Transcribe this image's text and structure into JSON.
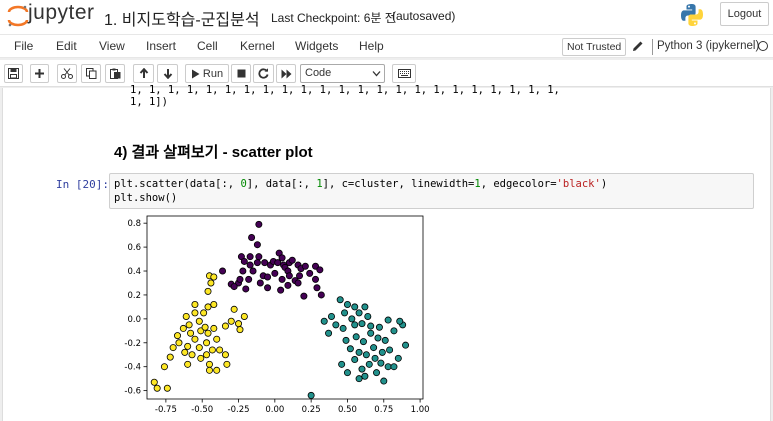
{
  "header": {
    "logo_text": "jupyter",
    "notebook_title": "1. 비지도학습-군집분석",
    "checkpoint": "Last Checkpoint: 6분 전",
    "autosaved": "(autosaved)",
    "logout_label": "Logout"
  },
  "menubar": {
    "items": [
      "File",
      "Edit",
      "View",
      "Insert",
      "Cell",
      "Kernel",
      "Widgets",
      "Help"
    ],
    "trust_label": "Not Trusted",
    "kernel_name": "Python 3 (ipykernel)"
  },
  "toolbar": {
    "run_label": "Run",
    "cell_type": "Code"
  },
  "notebook": {
    "output_tail_line1": "1, 1, 1, 1, 1, 1, 1, 1, 1, 1, 1, 1, 1, 1, 1, 1, 1, 1, 1, 1, 1, 1, 1,",
    "output_tail_line2": "1, 1])",
    "heading": "4) 결과 살펴보기 - scatter plot",
    "prompt": "In [20]:",
    "code_line1": "plt.scatter(data[:, 0], data[:, 1], c=cluster, linewidth=1, edgecolor='black')",
    "code_line2": "plt.show()"
  },
  "chart_data": {
    "type": "scatter",
    "title": "",
    "xlabel": "",
    "ylabel": "",
    "xlim": [
      -0.88,
      1.02
    ],
    "ylim": [
      -0.67,
      0.86
    ],
    "x_ticks": [
      "-0.75",
      "-0.50",
      "-0.25",
      "0.00",
      "0.25",
      "0.50",
      "0.75",
      "1.00"
    ],
    "x_tick_values": [
      -0.75,
      -0.5,
      -0.25,
      0.0,
      0.25,
      0.5,
      0.75,
      1.0
    ],
    "y_ticks": [
      "0.8",
      "0.6",
      "0.4",
      "0.2",
      "0.0",
      "-0.2",
      "-0.4",
      "-0.6"
    ],
    "y_tick_values": [
      0.8,
      0.6,
      0.4,
      0.2,
      0.0,
      -0.2,
      -0.4,
      -0.6
    ],
    "grid": false,
    "colors": {
      "cluster_0": "#440154",
      "cluster_1": "#21918c",
      "cluster_2": "#fde725"
    },
    "series": [
      {
        "cluster": 0,
        "points": [
          [
            -0.11,
            0.79
          ],
          [
            -0.16,
            0.68
          ],
          [
            -0.12,
            0.62
          ],
          [
            -0.23,
            0.52
          ],
          [
            -0.17,
            0.52
          ],
          [
            -0.11,
            0.52
          ],
          [
            -0.21,
            0.48
          ],
          [
            -0.12,
            0.47
          ],
          [
            -0.07,
            0.47
          ],
          [
            -0.17,
            0.45
          ],
          [
            -0.15,
            0.4
          ],
          [
            -0.22,
            0.4
          ],
          [
            -0.03,
            0.45
          ],
          [
            -0.01,
            0.48
          ],
          [
            0.03,
            0.55
          ],
          [
            0.02,
            0.47
          ],
          [
            0.05,
            0.51
          ],
          [
            0.06,
            0.45
          ],
          [
            0.1,
            0.47
          ],
          [
            0.12,
            0.49
          ],
          [
            0.07,
            0.43
          ],
          [
            0.09,
            0.4
          ],
          [
            0.16,
            0.45
          ],
          [
            0.18,
            0.42
          ],
          [
            0.21,
            0.44
          ],
          [
            0.28,
            0.44
          ],
          [
            0.31,
            0.41
          ],
          [
            -0.25,
            0.3
          ],
          [
            -0.3,
            0.29
          ],
          [
            -0.24,
            0.33
          ],
          [
            -0.18,
            0.33
          ],
          [
            -0.1,
            0.3
          ],
          [
            -0.08,
            0.36
          ],
          [
            -0.05,
            0.35
          ],
          [
            0.0,
            0.38
          ],
          [
            0.05,
            0.33
          ],
          [
            0.1,
            0.36
          ],
          [
            0.14,
            0.32
          ],
          [
            0.17,
            0.36
          ],
          [
            -0.36,
            0.4
          ],
          [
            -0.28,
            0.27
          ],
          [
            -0.05,
            0.26
          ],
          [
            0.04,
            0.24
          ],
          [
            0.09,
            0.28
          ],
          [
            0.16,
            0.3
          ],
          [
            0.24,
            0.38
          ],
          [
            0.28,
            0.33
          ],
          [
            0.29,
            0.26
          ],
          [
            0.2,
            0.19
          ],
          [
            0.32,
            0.2
          ],
          [
            -0.2,
            0.25
          ]
        ]
      },
      {
        "cluster": 1,
        "points": [
          [
            0.45,
            0.16
          ],
          [
            0.5,
            0.12
          ],
          [
            0.55,
            0.1
          ],
          [
            0.62,
            0.1
          ],
          [
            0.58,
            0.05
          ],
          [
            0.64,
            0.02
          ],
          [
            0.48,
            0.05
          ],
          [
            0.53,
            0.0
          ],
          [
            0.39,
            0.02
          ],
          [
            0.34,
            -0.02
          ],
          [
            0.42,
            -0.05
          ],
          [
            0.47,
            -0.08
          ],
          [
            0.55,
            -0.05
          ],
          [
            0.6,
            -0.04
          ],
          [
            0.66,
            -0.06
          ],
          [
            0.72,
            -0.07
          ],
          [
            0.66,
            -0.12
          ],
          [
            0.71,
            -0.16
          ],
          [
            0.76,
            -0.18
          ],
          [
            0.82,
            -0.1
          ],
          [
            0.88,
            -0.05
          ],
          [
            0.86,
            -0.02
          ],
          [
            0.78,
            -0.01
          ],
          [
            0.49,
            -0.18
          ],
          [
            0.56,
            -0.15
          ],
          [
            0.61,
            -0.19
          ],
          [
            0.68,
            -0.24
          ],
          [
            0.74,
            -0.28
          ],
          [
            0.79,
            -0.26
          ],
          [
            0.85,
            -0.33
          ],
          [
            0.52,
            -0.25
          ],
          [
            0.58,
            -0.28
          ],
          [
            0.63,
            -0.3
          ],
          [
            0.69,
            -0.33
          ],
          [
            0.73,
            -0.37
          ],
          [
            0.78,
            -0.4
          ],
          [
            0.82,
            -0.4
          ],
          [
            0.9,
            -0.22
          ],
          [
            0.65,
            -0.38
          ],
          [
            0.6,
            -0.42
          ],
          [
            0.55,
            -0.34
          ],
          [
            0.46,
            -0.38
          ],
          [
            0.5,
            -0.45
          ],
          [
            0.58,
            -0.5
          ],
          [
            0.7,
            -0.45
          ],
          [
            0.75,
            -0.52
          ],
          [
            0.62,
            -0.48
          ],
          [
            0.37,
            -0.12
          ],
          [
            0.25,
            -0.64
          ]
        ]
      },
      {
        "cluster": 2,
        "points": [
          [
            -0.45,
            0.36
          ],
          [
            -0.42,
            0.35
          ],
          [
            -0.44,
            0.3
          ],
          [
            -0.46,
            0.23
          ],
          [
            -0.55,
            0.12
          ],
          [
            -0.46,
            0.1
          ],
          [
            -0.42,
            0.12
          ],
          [
            -0.49,
            0.05
          ],
          [
            -0.55,
            0.05
          ],
          [
            -0.61,
            0.02
          ],
          [
            -0.52,
            -0.02
          ],
          [
            -0.59,
            -0.05
          ],
          [
            -0.63,
            -0.08
          ],
          [
            -0.67,
            -0.14
          ],
          [
            -0.58,
            -0.12
          ],
          [
            -0.55,
            -0.17
          ],
          [
            -0.51,
            -0.1
          ],
          [
            -0.48,
            -0.07
          ],
          [
            -0.46,
            -0.12
          ],
          [
            -0.42,
            -0.08
          ],
          [
            -0.4,
            -0.17
          ],
          [
            -0.47,
            -0.2
          ],
          [
            -0.52,
            -0.24
          ],
          [
            -0.6,
            -0.23
          ],
          [
            -0.66,
            -0.2
          ],
          [
            -0.7,
            -0.24
          ],
          [
            -0.62,
            -0.28
          ],
          [
            -0.57,
            -0.3
          ],
          [
            -0.51,
            -0.33
          ],
          [
            -0.47,
            -0.3
          ],
          [
            -0.43,
            -0.26
          ],
          [
            -0.45,
            -0.38
          ],
          [
            -0.38,
            -0.26
          ],
          [
            -0.34,
            -0.3
          ],
          [
            -0.34,
            -0.06
          ],
          [
            -0.3,
            -0.02
          ],
          [
            -0.25,
            -0.04
          ],
          [
            -0.21,
            0.02
          ],
          [
            -0.28,
            0.08
          ],
          [
            -0.24,
            -0.09
          ],
          [
            -0.72,
            -0.32
          ],
          [
            -0.6,
            -0.38
          ],
          [
            -0.4,
            -0.43
          ],
          [
            -0.33,
            -0.38
          ],
          [
            -0.83,
            -0.53
          ],
          [
            -0.81,
            -0.58
          ],
          [
            -0.74,
            -0.58
          ],
          [
            -0.76,
            -0.4
          ],
          [
            -0.45,
            -0.43
          ]
        ]
      }
    ]
  }
}
